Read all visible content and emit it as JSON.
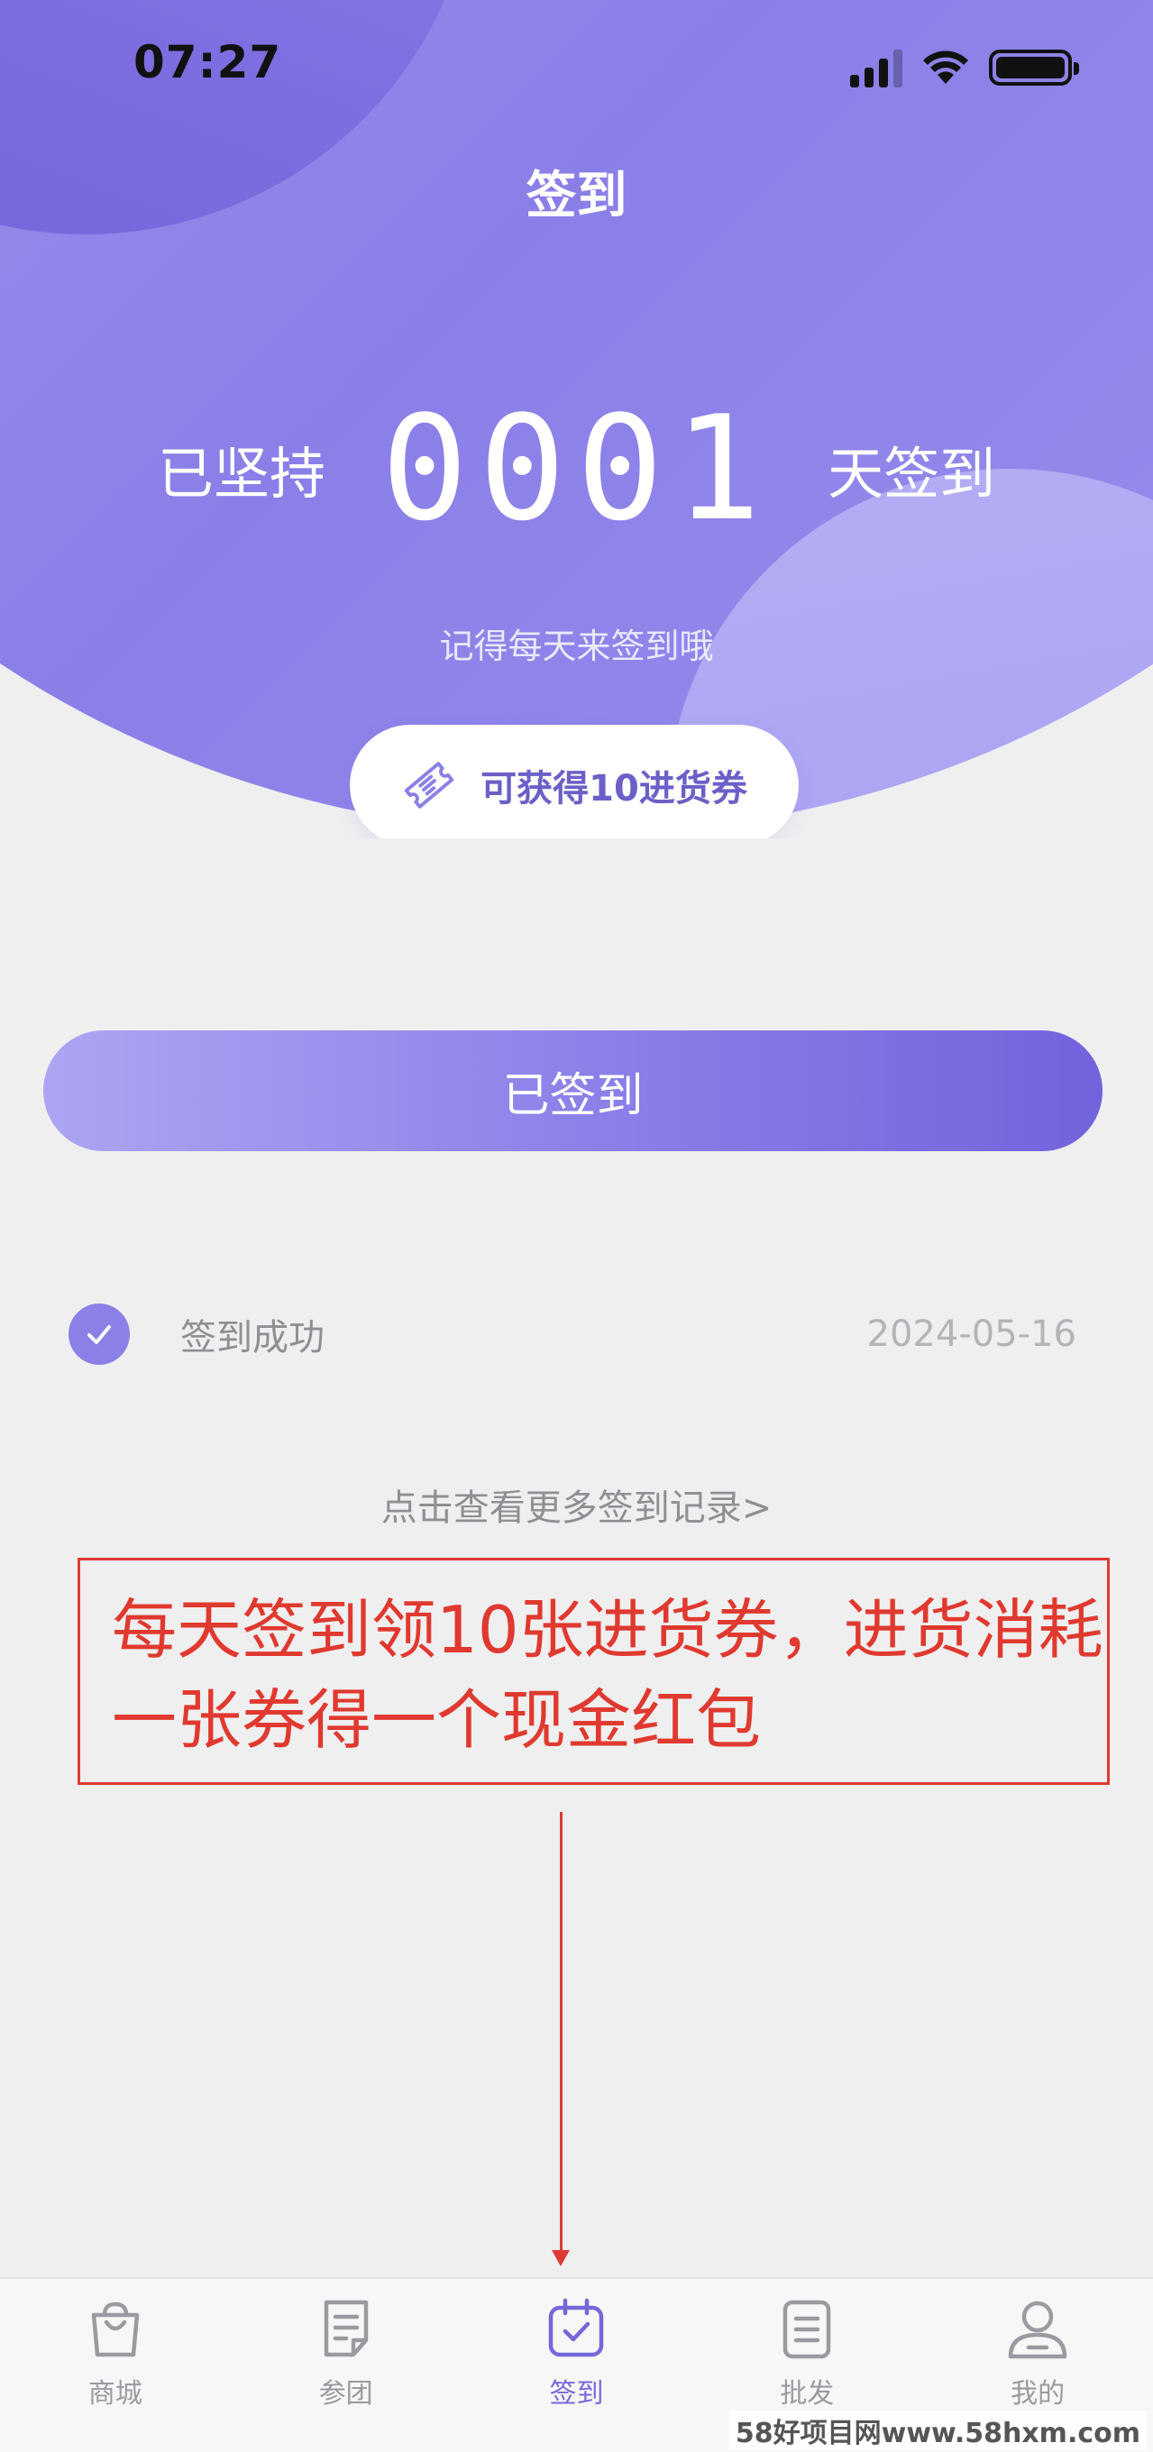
{
  "status_bar": {
    "time": "07:27"
  },
  "header": {
    "title": "签到",
    "streak_prefix": "已坚持",
    "streak_count": "0001",
    "streak_suffix": "天签到",
    "reminder": "记得每天来签到哦",
    "coupon_text": "可获得10进货券"
  },
  "sign_button": {
    "label": "已签到"
  },
  "records": [
    {
      "label": "签到成功",
      "date": "2024-05-16"
    }
  ],
  "more_records_link": "点击查看更多签到记录>",
  "annotation": {
    "line1": "每天签到领10张进货券，进货消耗",
    "line2": "一张券得一个现金红包"
  },
  "tabbar": {
    "tabs": [
      {
        "label": "商城",
        "icon": "shopping-bag-icon",
        "active": false
      },
      {
        "label": "参团",
        "icon": "document-icon",
        "active": false
      },
      {
        "label": "签到",
        "icon": "calendar-check-icon",
        "active": true
      },
      {
        "label": "批发",
        "icon": "list-document-icon",
        "active": false
      },
      {
        "label": "我的",
        "icon": "user-icon",
        "active": false
      }
    ]
  },
  "watermark": "58好项目网www.58hxm.com",
  "colors": {
    "accent": "#7468d8",
    "header_purple": "#8a7fe7",
    "annotation_red": "#e0392f",
    "page_bg": "#efeff0"
  }
}
